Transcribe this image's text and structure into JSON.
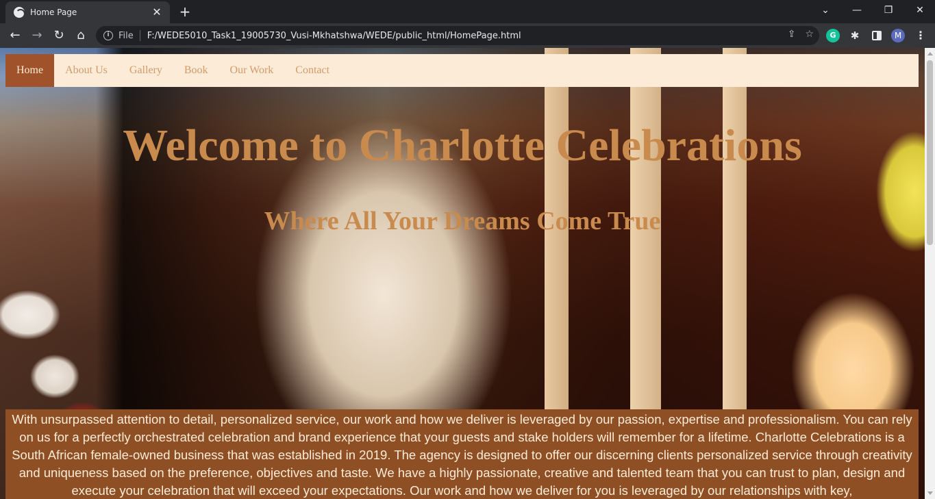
{
  "browser": {
    "tab": {
      "title": "Home Page",
      "close_glyph": "✕"
    },
    "new_tab_glyph": "+",
    "window_controls": {
      "dropdown": "⌄",
      "minimize": "—",
      "maximize": "❐",
      "close": "✕"
    },
    "toolbar": {
      "back_glyph": "←",
      "forward_glyph": "→",
      "reload_glyph": "↻",
      "home_glyph": "⌂",
      "scheme_label": "File",
      "url": "F:/WEDE5010_Task1_19005730_Vusi-Mkhatshwa/WEDE/public_html/HomePage.html",
      "share_glyph": "⇪",
      "star_glyph": "☆",
      "grammarly_label": "G",
      "extensions_glyph": "✱",
      "profile_initial": "M",
      "menu_glyph": "⋮"
    }
  },
  "site": {
    "nav": [
      {
        "label": "Home",
        "active": true
      },
      {
        "label": "About Us"
      },
      {
        "label": "Gallery"
      },
      {
        "label": "Book"
      },
      {
        "label": "Our Work"
      },
      {
        "label": "Contact"
      }
    ],
    "hero_title": "Welcome to Charlotte Celebrations",
    "hero_subtitle": "Where All Your Dreams Come True",
    "about_text": "With unsurpassed attention to detail, personalized service, our work and how we deliver is leveraged by our passion, expertise and professionalism. You can rely on us for a perfectly orchestrated celebration and brand experience that your guests and stake holders will remember for a lifetime. Charlotte Celebrations is a South African female-owned business that was established in 2019. The agency is designed to offer our discerning clients personalized service through creativity and uniqueness based on the preference, objectives and taste. We have a highly passionate, creative and talented team that you can trust to plan, design and execute your celebration that will exceed your expectations. Our work and how we deliver for you is leveraged by our relationships with key,"
  },
  "colors": {
    "nav_bg": "#fcebd6",
    "nav_active_bg": "#a0532a",
    "nav_text": "#d39a6a",
    "heading": "#c98a4e",
    "about_bg": "#8f4f25",
    "about_text": "#fcebd6"
  },
  "icons": [
    "globe-icon",
    "close-icon",
    "plus-icon",
    "chevron-down-icon",
    "minimize-icon",
    "maximize-icon",
    "back-arrow-icon",
    "forward-arrow-icon",
    "reload-icon",
    "home-icon",
    "info-icon",
    "share-icon",
    "star-icon",
    "grammarly-icon",
    "puzzle-icon",
    "side-panel-icon",
    "avatar",
    "kebab-menu-icon"
  ]
}
